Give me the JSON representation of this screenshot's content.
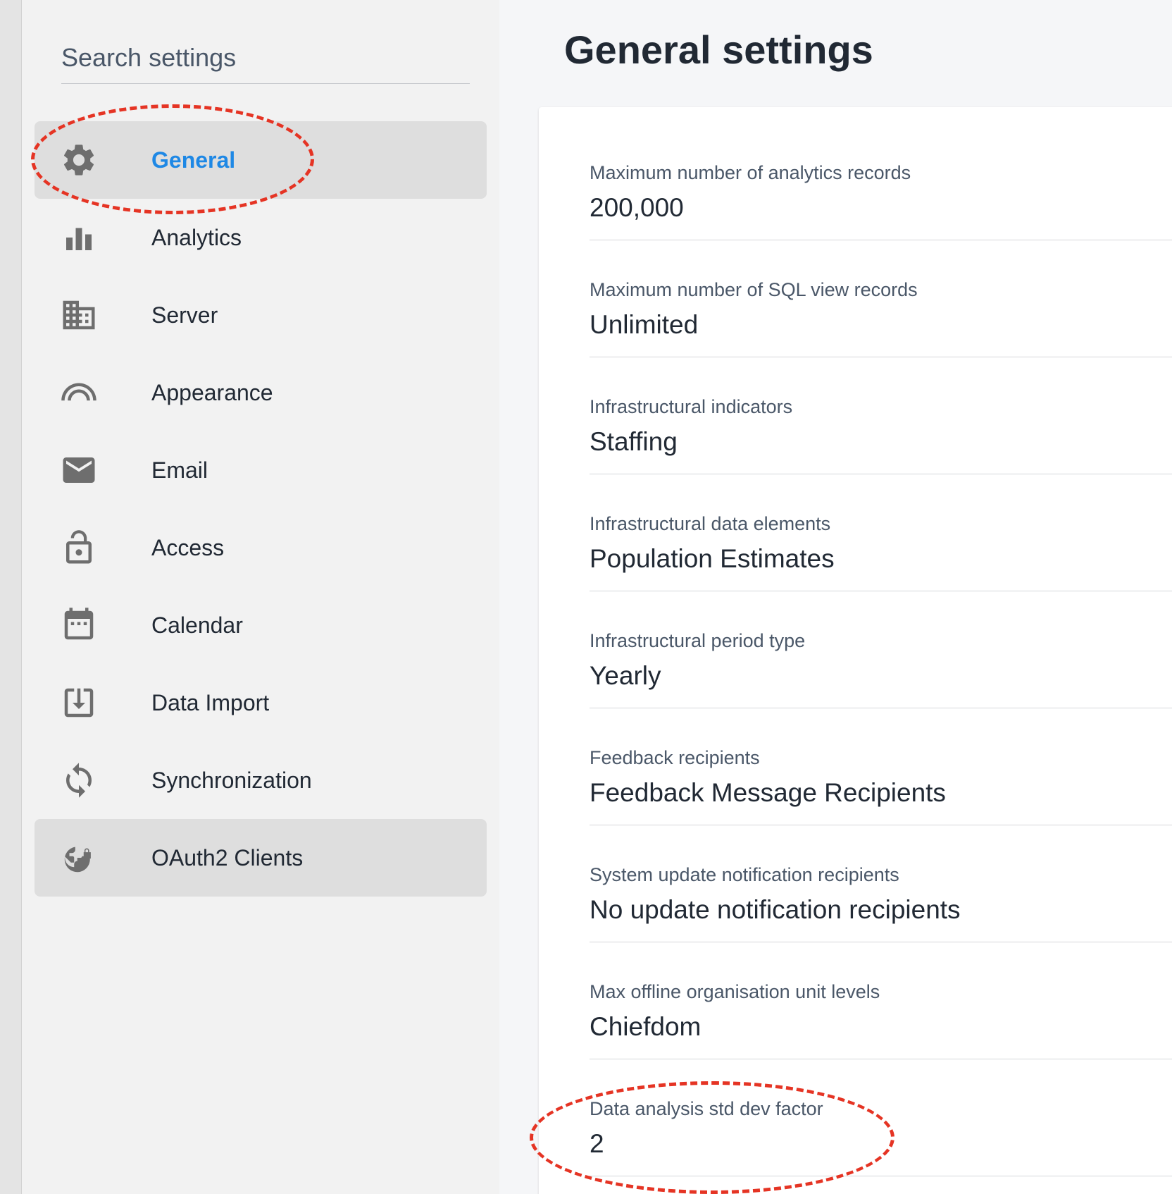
{
  "search": {
    "placeholder": "Search settings"
  },
  "sidebar": {
    "items": [
      {
        "label": "General",
        "icon": "gear-icon",
        "active": true
      },
      {
        "label": "Analytics",
        "icon": "bar-chart-icon"
      },
      {
        "label": "Server",
        "icon": "building-icon"
      },
      {
        "label": "Appearance",
        "icon": "rainbow-icon"
      },
      {
        "label": "Email",
        "icon": "envelope-icon"
      },
      {
        "label": "Access",
        "icon": "lock-icon"
      },
      {
        "label": "Calendar",
        "icon": "calendar-icon"
      },
      {
        "label": "Data Import",
        "icon": "import-icon"
      },
      {
        "label": "Synchronization",
        "icon": "sync-icon"
      },
      {
        "label": "OAuth2 Clients",
        "icon": "globe-lock-icon",
        "hovered": true
      }
    ]
  },
  "main": {
    "title": "General settings",
    "settings": [
      {
        "label": "Maximum number of analytics records",
        "value": "200,000"
      },
      {
        "label": "Maximum number of SQL view records",
        "value": "Unlimited"
      },
      {
        "label": "Infrastructural indicators",
        "value": "Staffing"
      },
      {
        "label": "Infrastructural data elements",
        "value": "Population Estimates"
      },
      {
        "label": "Infrastructural period type",
        "value": "Yearly"
      },
      {
        "label": "Feedback recipients",
        "value": "Feedback Message Recipients"
      },
      {
        "label": "System update notification recipients",
        "value": "No update notification recipients"
      },
      {
        "label": "Max offline organisation unit levels",
        "value": "Chiefdom"
      },
      {
        "label": "Data analysis std dev factor",
        "value": "2"
      }
    ]
  },
  "colors": {
    "accent": "#1e88e5",
    "annotation": "#e53424",
    "icon": "#6e6e6e"
  }
}
